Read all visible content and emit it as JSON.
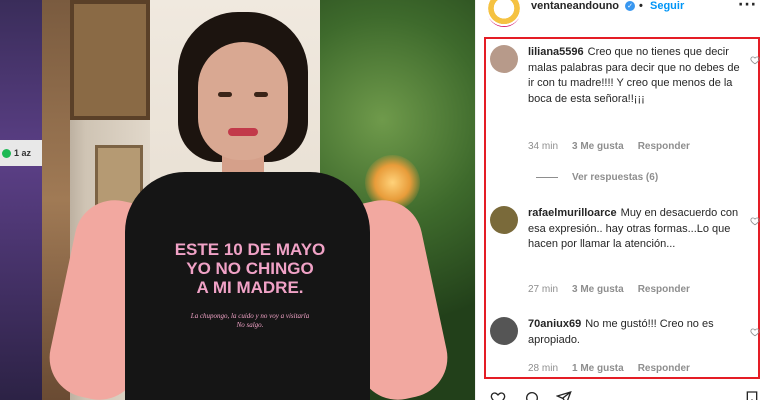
{
  "post": {
    "username": "ventaneandouno",
    "verified_mark": "✓",
    "separator": "•",
    "follow_label": "Seguir",
    "more_label": "···"
  },
  "photo": {
    "strip_badge_text": "1 az",
    "shirt_main": "ESTE 10 DE MAYO\nYO NO CHINGO\nA MI MADRE.",
    "shirt_small": "La chupongo, la cuido y no voy a visitarla\nNo salgo."
  },
  "comments": [
    {
      "username": "liliana5596",
      "text": "Creo que no tienes que decir malas palabras para decir que no debes de ir con tu madre!!!! Y creo que menos de la boca de esta señora!!¡¡¡",
      "time": "34 min",
      "likes": "3 Me gusta",
      "reply": "Responder",
      "avatar_color": "#b79a8a"
    },
    {
      "username": "rafaelmurilloarce",
      "text": "Muy en desacuerdo con esa expresión.. hay otras formas...Lo que hacen por llamar la atención...",
      "time": "27 min",
      "likes": "3 Me gusta",
      "reply": "Responder",
      "avatar_color": "#7a6a3a"
    },
    {
      "username": "70aniux69",
      "text": "No me gustó!!! Creo no es apropiado.",
      "time": "28 min",
      "likes": "1 Me gusta",
      "reply": "Responder",
      "avatar_color": "#555555"
    }
  ],
  "view_replies": "Ver respuestas (6)",
  "colors": {
    "highlight": "#e41d25",
    "link": "#0095f6",
    "muted": "#8e8e8e"
  },
  "icons": [
    "heart-icon",
    "comment-icon",
    "share-icon",
    "bookmark-icon",
    "more-icon",
    "verified-icon"
  ]
}
